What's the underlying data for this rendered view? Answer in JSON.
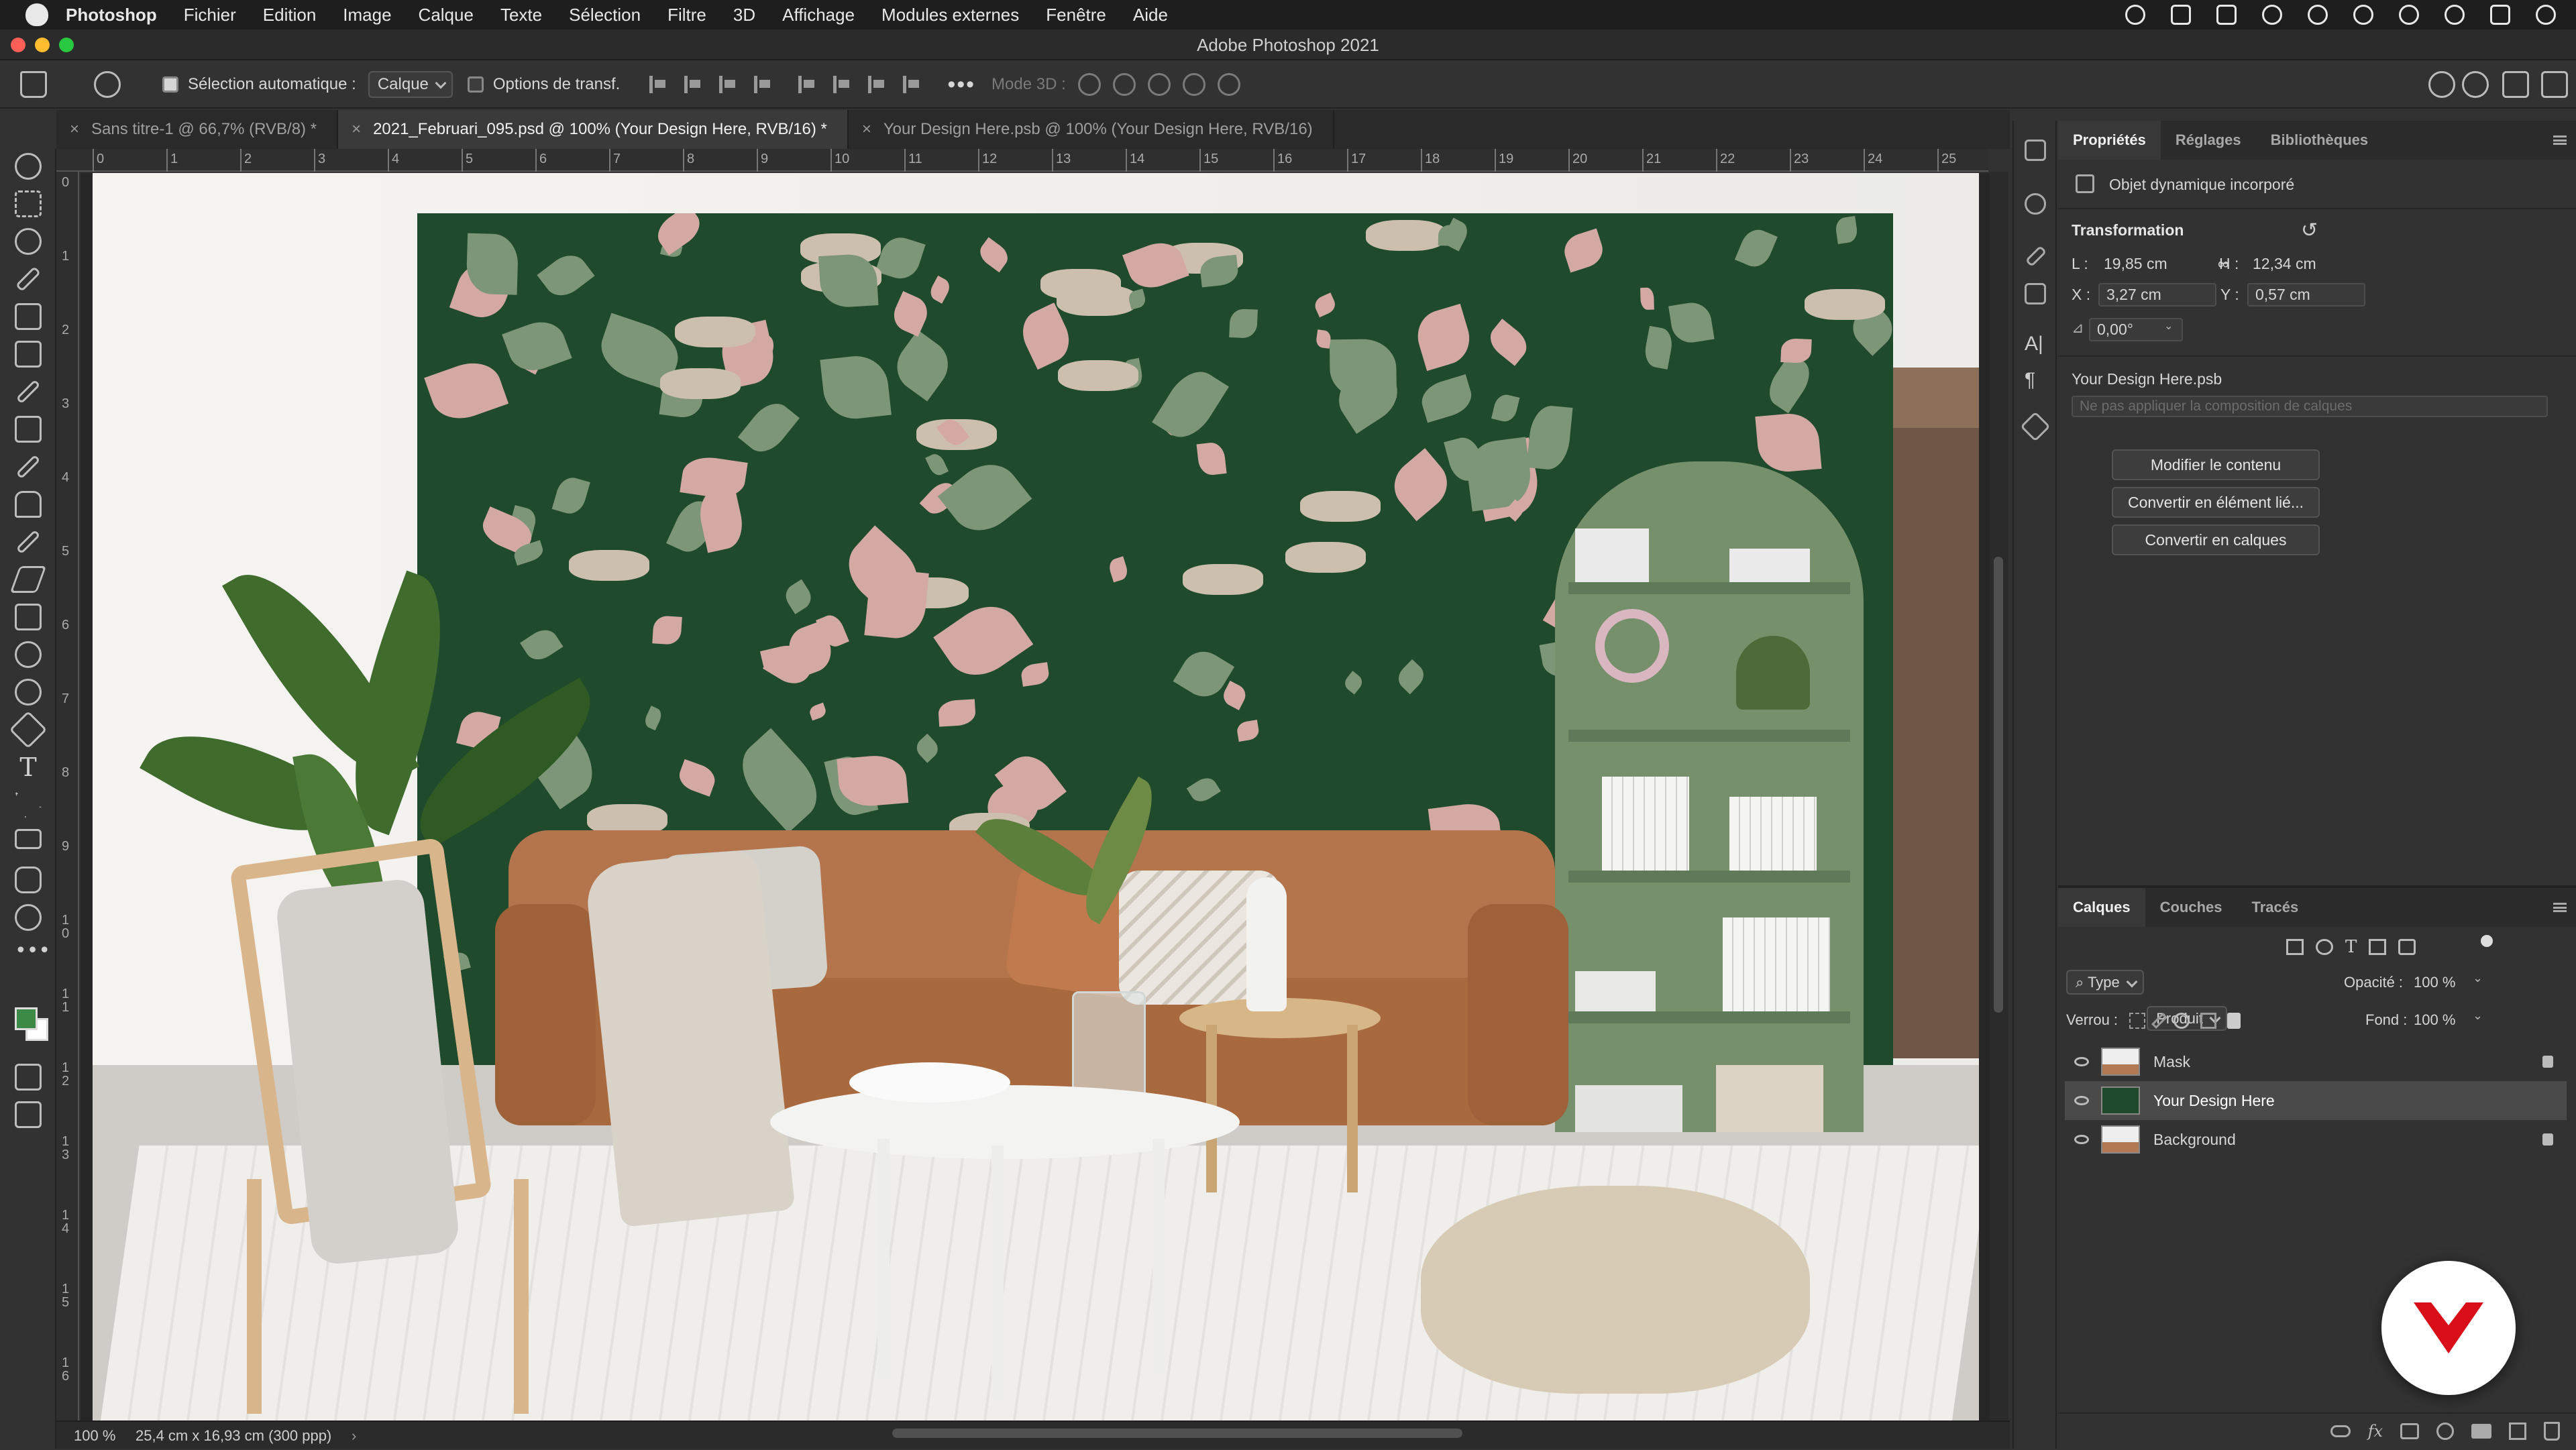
{
  "menubar": {
    "app": "Photoshop",
    "items": [
      "Fichier",
      "Edition",
      "Image",
      "Calque",
      "Texte",
      "Sélection",
      "Filtre",
      "3D",
      "Affichage",
      "Modules externes",
      "Fenêtre",
      "Aide"
    ]
  },
  "window": {
    "title": "Adobe Photoshop 2021"
  },
  "options": {
    "auto_select_label": "Sélection automatique :",
    "auto_select_value": "Calque",
    "transform_label": "Options de transf.",
    "mode3d_label": "Mode 3D :"
  },
  "tabs": [
    {
      "label": "Sans titre-1 @ 66,7% (RVB/8) *"
    },
    {
      "label": "2021_Februari_095.psd @ 100% (Your Design Here, RVB/16) *"
    },
    {
      "label": "Your Design Here.psb @ 100% (Your Design Here, RVB/16)"
    }
  ],
  "ruler": {
    "h_ticks": [
      "0",
      "1",
      "2",
      "3",
      "4",
      "5",
      "6",
      "7",
      "8",
      "9",
      "10",
      "11",
      "12",
      "13",
      "14",
      "15",
      "16",
      "17",
      "18",
      "19",
      "20",
      "21",
      "22",
      "23",
      "24",
      "25"
    ],
    "v_ticks": [
      "0",
      "1",
      "2",
      "3",
      "4",
      "5",
      "6",
      "7",
      "8",
      "9",
      "1 0",
      "1 1",
      "1 2",
      "1 3",
      "1 4",
      "1 5",
      "1 6"
    ]
  },
  "properties": {
    "tabs": [
      "Propriétés",
      "Réglages",
      "Bibliothèques"
    ],
    "object_type": "Objet dynamique incorporé",
    "transform_title": "Transformation",
    "w_label": "L :",
    "w_value": "19,85 cm",
    "h_label": "H :",
    "h_value": "12,34 cm",
    "x_label": "X :",
    "x_value": "3,27 cm",
    "y_label": "Y :",
    "y_value": "0,57 cm",
    "angle_value": "0,00°",
    "file_name": "Your Design Here.psb",
    "comp_placeholder": "Ne pas appliquer la composition de calques",
    "buttons": [
      "Modifier le contenu",
      "Convertir en élément lié...",
      "Convertir en calques"
    ]
  },
  "layers": {
    "tabs": [
      "Calques",
      "Couches",
      "Tracés"
    ],
    "filter_label": "Type",
    "blend_mode": "Produit",
    "opacity_label": "Opacité :",
    "opacity_value": "100 %",
    "lock_label": "Verrou :",
    "fill_label": "Fond :",
    "fill_value": "100 %",
    "items": [
      {
        "name": "Mask",
        "locked": true,
        "selected": false
      },
      {
        "name": "Your Design Here",
        "locked": false,
        "selected": true
      },
      {
        "name": "Background",
        "locked": true,
        "selected": false
      }
    ]
  },
  "status": {
    "zoom": "100 %",
    "doc_info": "25,4 cm x 16,93 cm (300 ppp)"
  },
  "colors": {
    "foreground": "#3c8a45",
    "background": "#ffffff",
    "accent": "#d80f19"
  }
}
